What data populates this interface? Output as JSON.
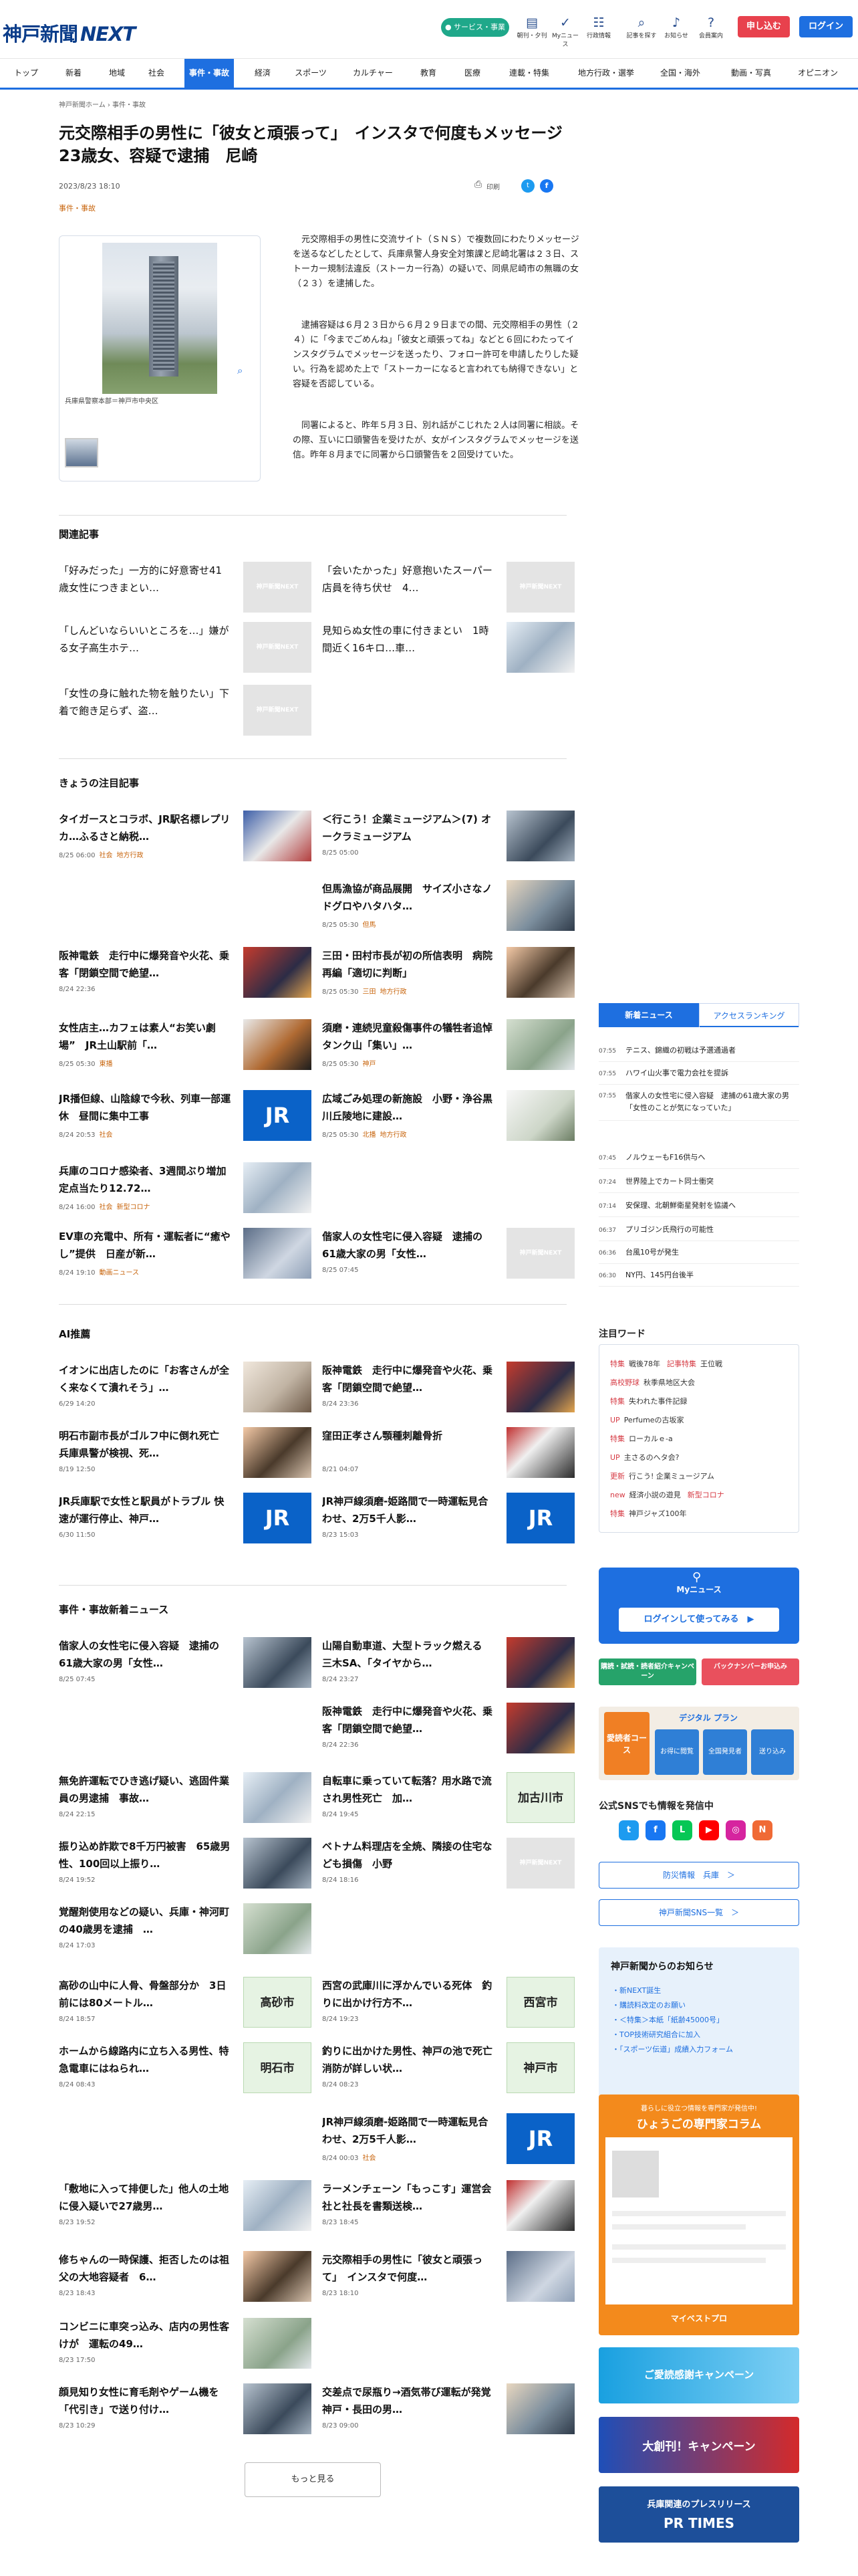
{
  "header": {
    "logo": "神戸新聞",
    "logo_next": "NEXT",
    "service_btn": "● サービス・事業",
    "icons": [
      {
        "label": "朝刊・夕刊",
        "glyph": "▤"
      },
      {
        "label": "Myニュース",
        "glyph": "✓"
      },
      {
        "label": "行政情報",
        "glyph": "☷"
      },
      {
        "label": "記事を探す",
        "glyph": "⌕"
      },
      {
        "label": "お知らせ",
        "glyph": "♪"
      },
      {
        "label": "会員案内",
        "glyph": "?"
      }
    ],
    "subscribe": "申し込む",
    "login": "ログイン"
  },
  "nav": [
    "トップ",
    "新着",
    "地域",
    "社会",
    "事件・事故",
    "経済",
    "スポーツ",
    "カルチャー",
    "教育",
    "医療",
    "連載・特集",
    "地方行政・選挙",
    "全国・海外",
    "動画・写真",
    "オピニオン"
  ],
  "breadcrumb": "神戸新聞ホーム › 事件・事故",
  "article": {
    "headline": "元交際相手の男性に「彼女と頑張って」　インスタで何度もメッセージ　23歳女、容疑で逮捕　尼崎",
    "date": "2023/8/23 18:10",
    "category": "事件・事故",
    "print": "印刷",
    "caption": "兵庫県警察本部＝神戸市中央区",
    "paragraphs": [
      "元交際相手の男性に交流サイト（ＳＮＳ）で複数回にわたりメッセージを送るなどしたとして、兵庫県警人身安全対策課と尼崎北署は２３日、ストーカー規制法違反（ストーカー行為）の疑いで、同県尼崎市の無職の女（２３）を逮捕した。",
      "逮捕容疑は６月２３日から６月２９日までの間、元交際相手の男性（２４）に「今までごめんね」「彼女と頑張ってね」などと６回にわたってインスタグラムでメッセージを送ったり、フォロー許可を申請したりした疑い。行為を認めた上で「ストーカーになると言われても納得できない」と容疑を否認している。",
      "同署によると、昨年５月３日、別れ話がこじれた２人は同署に相談。その際、互いに口頭警告を受けたが、女がインスタグラムでメッセージを送信。昨年８月までに同署から口頭警告を２回受けていた。"
    ]
  },
  "related": {
    "title": "関連記事",
    "items": [
      "「好みだった」一方的に好意寄せ41歳女性につきまとい…",
      "「会いたかった」好意抱いたスーパー店員を待ち伏せ　4…",
      "「しんどいならいいところを…」嫌がる女子高生ホテ…",
      "見知らぬ女性の車に付きまとい　1時間近く16キロ…車…",
      "「女性の身に触れた物を触りたい」下着で飽き足らず、盗…"
    ],
    "noimage": "神戸新聞NEXT"
  },
  "featured": {
    "title": "きょうの注目記事",
    "items": [
      {
        "t": "タイガースとコラボ、JR駅名標レプリカ…ふるさと納税…",
        "d": "8/25 06:00",
        "tags": [
          "社会",
          "地方行政"
        ]
      },
      {
        "t": "＜行こう！企業ミュージアム＞(7) オークラミュージアム",
        "d": "8/25 05:00",
        "tags": []
      },
      {
        "t": "但馬漁協が商品展開　サイズ小さなノドグロやハタハタ…",
        "d": "8/25 05:30",
        "tags": [
          "但馬"
        ]
      },
      {
        "t": "阪神電鉄　走行中に爆発音や火花、乗客「閉鎖空間で絶望…",
        "d": "8/24 22:36",
        "tags": []
      },
      {
        "t": "三田・田村市長が初の所信表明　病院再編「適切に判断」",
        "d": "8/25 05:30",
        "tags": [
          "三田",
          "地方行政"
        ]
      },
      {
        "t": "女性店主…カフェは素人“お笑い劇場”　JR土山駅前「…",
        "d": "8/25 05:30",
        "tags": [
          "東播"
        ]
      },
      {
        "t": "須磨・連続児童殺傷事件の犠牲者追悼　タンク山「集い」…",
        "d": "8/25 05:30",
        "tags": [
          "神戸"
        ]
      },
      {
        "t": "JR播但線、山陰線で今秋、列車一部運休　昼間に集中工事",
        "d": "8/24 20:53",
        "tags": [
          "社会"
        ]
      },
      {
        "t": "広域ごみ処理の新施設　小野・浄谷黒川丘陵地に建設…",
        "d": "8/25 05:30",
        "tags": [
          "北播",
          "地方行政"
        ]
      },
      {
        "t": "兵庫のコロナ感染者、3週間ぶり増加　定点当たり12.72…",
        "d": "8/24 16:00",
        "tags": [
          "社会",
          "新型コロナ"
        ]
      },
      {
        "t": "EV車の充電中、所有・運転者に“癒やし”提供　日産が新…",
        "d": "8/24 19:10",
        "tags": [
          "動画ニュース"
        ]
      },
      {
        "t": "偕家人の女性宅に侵入容疑　逮捕の61歳大家の男「女性…",
        "d": "8/25 07:45",
        "tags": []
      }
    ]
  },
  "ai": {
    "title": "AI推薦",
    "items": [
      {
        "t": "イオンに出店したのに「お客さんが全く来なくて潰れそう」…",
        "d": "6/29 14:20"
      },
      {
        "t": "阪神電鉄　走行中に爆発音や火花、乗客「閉鎖空間で絶望…",
        "d": "8/24 23:36"
      },
      {
        "t": "明石市副市長がゴルフ中に倒れ死亡　兵庫県警が検視、死…",
        "d": "8/19 12:50"
      },
      {
        "t": "窪田正孝さん顎種刺離骨折",
        "d": "8/21 04:07"
      },
      {
        "t": "JR兵庫駅で女性と駅員がトラブル 快速が運行停止、神戸…",
        "d": "6/30 11:50"
      },
      {
        "t": "JR神戸線須磨-姫路間で一時運転見合わせ、2万5千人影…",
        "d": "8/23 15:03"
      }
    ]
  },
  "latest": {
    "title": "事件・事故新着ニュース",
    "items": [
      {
        "t": "偕家人の女性宅に侵入容疑　逮捕の61歳大家の男「女性…",
        "d": "8/25 07:45"
      },
      {
        "t": "山陽自動車道、大型トラック燃える　三木SA、「タイヤから…",
        "d": "8/24 23:27"
      },
      {
        "t": "阪神電鉄　走行中に爆発音や火花、乗客「閉鎖空間で絶望…",
        "d": "8/24 22:36"
      },
      {
        "t": "無免許運転でひき逃げ疑い、逃固件業員の男逮捕　事故…",
        "d": "8/24 22:15"
      },
      {
        "t": "自転車に乗っていて転落？用水路で流され男性死亡　加…",
        "d": "8/24 19:45"
      },
      {
        "t": "振り込め詐欺で8千万円被害　65歳男性、100回以上振り…",
        "d": "8/24 19:52"
      },
      {
        "t": "ベトナム料理店を全焼、隣接の住宅なども損傷　小野",
        "d": "8/24 18:16"
      },
      {
        "t": "覚醒剤使用などの疑い、兵庫・神河町の40歳男を逮捕　…",
        "d": "8/24 17:03"
      },
      {
        "t": "高砂の山中に人骨、骨盤部分か　3日前には80メートル…",
        "d": "8/24 18:57"
      },
      {
        "t": "西宮の武庫川に浮かんでいる死体　釣りに出かけ行方不…",
        "d": "8/24 19:23"
      },
      {
        "t": "ホームから線路内に立ち入る男性、特急電車にはねられ…",
        "d": "8/24 08:43"
      },
      {
        "t": "釣りに出かけた男性、神戸の池で死亡　消防が詳しい状…",
        "d": "8/24 08:23"
      },
      {
        "t": "JR神戸線須磨-姫路間で一時運転見合わせ、2万5千人影…",
        "d": "8/24 00:03",
        "tag": "社会"
      },
      {
        "t": "「敷地に入って排便した」他人の土地に侵入疑いで27歳男…",
        "d": "8/23 19:52"
      },
      {
        "t": "ラーメンチェーン「もっこす」運営会社と社長を書類送検…",
        "d": "8/23 18:45"
      },
      {
        "t": "修ちゃんの一時保護、拒否したのは祖父の大地容疑者　6…",
        "d": "8/23 18:43"
      },
      {
        "t": "元交際相手の男性に「彼女と頑張って」　インスタで何度…",
        "d": "8/23 18:10"
      },
      {
        "t": "コンビニに車突っ込み、店内の男性客けが　運転の49…",
        "d": "8/23 17:50"
      },
      {
        "t": "顔見知り女性に育毛剤やゲーム機を「代引き」で送り付け…",
        "d": "8/23 10:29"
      },
      {
        "t": "交差点で尿瓶り→酒気帯び運転が発覚　神戸・長田の男…",
        "d": "8/23 09:00"
      }
    ],
    "cities": [
      "加古川市",
      "高砂市",
      "西宮市",
      "明石市",
      "神戸市"
    ],
    "jr": "JR",
    "more": "もっと見る"
  },
  "sidebar": {
    "tabs": [
      "新着ニュース",
      "アクセスランキング"
    ],
    "news": [
      {
        "tm": "07:55",
        "tx": "テニス、錦織の初戦は予選通過者"
      },
      {
        "tm": "07:55",
        "tx": "ハワイ山火事で電力会社を提訴"
      },
      {
        "tm": "07:55",
        "tx": "偕家人の女性宅に侵入容疑　逮捕の61歳大家の男「女性のことが気になっていた」"
      },
      {
        "tm": "07:45",
        "tx": "ノルウェーもF16供与へ"
      },
      {
        "tm": "07:24",
        "tx": "世界陸上でカート同士衝突"
      },
      {
        "tm": "07:14",
        "tx": "安保理、北朝鮮衛星発射を協議へ"
      },
      {
        "tm": "06:37",
        "tx": "プリゴジン氏飛行の可能性"
      },
      {
        "tm": "06:36",
        "tx": "台風10号が発生"
      },
      {
        "tm": "06:30",
        "tx": "NY円、145円台後半"
      }
    ],
    "kw_title": "注目ワード",
    "keywords": [
      {
        "k": "特集",
        "w": "戦後78年",
        "k2": "記事特集",
        "w2": "王位戦"
      },
      {
        "k": "高校野球",
        "w": "秋季県地区大会"
      },
      {
        "k": "特集",
        "w": "失われた事件記録"
      },
      {
        "k": "UP",
        "w": "Perfumeの古坂家"
      },
      {
        "k": "特集",
        "w": "ローカルｅ-a"
      },
      {
        "k": "UP",
        "w": "主さるのへタ会?"
      },
      {
        "k": "更新",
        "w": "行こう! 企業ミュージアム"
      },
      {
        "k": "new",
        "w": "経済小説の遊見",
        "k2": "新型コロナ"
      },
      {
        "k": "特集",
        "w": "神戸ジャズ100年"
      }
    ],
    "myn_label": "Myニュース",
    "myn_btn": "ログインして使ってみる　▶",
    "promo1": "購読・試読・読者紹介キャンペーン",
    "promo2": "バックナンバーお申込み",
    "dig1": "愛読者コース",
    "dig2": "デジタル プラン",
    "dig3": [
      "お得に閲覧",
      "全国発見者",
      "送り込み"
    ],
    "sns_title": "公式SNSでも情報を発信中",
    "sns": [
      "t",
      "f",
      "L",
      "▶",
      "◎",
      "N"
    ],
    "btn1": "防災情報　兵庫　＞",
    "btn2": "神戸新聞SNS一覧　＞",
    "noti_title": "神戸新聞からのお知らせ",
    "noti": [
      "・新NEXT誕生",
      "・購読料改定のお願い",
      "・＜特集＞本紙「紙齢45000号」",
      "・TOP技術研究組合に加入",
      "・「スポーツ伝道」成績入力フォーム"
    ],
    "column_sub": "暮らしに役立つ情報を専門家が発信中!",
    "column_title": "ひょうごの専門家コラム",
    "column_foot": "マイベストプロ",
    "ad1": "ご愛読感謝キャンペーン",
    "ad2": "大創刊！キャンペーン",
    "ad3": "兵庫関連のプレスリリース",
    "ad3b": "PR TIMES"
  }
}
